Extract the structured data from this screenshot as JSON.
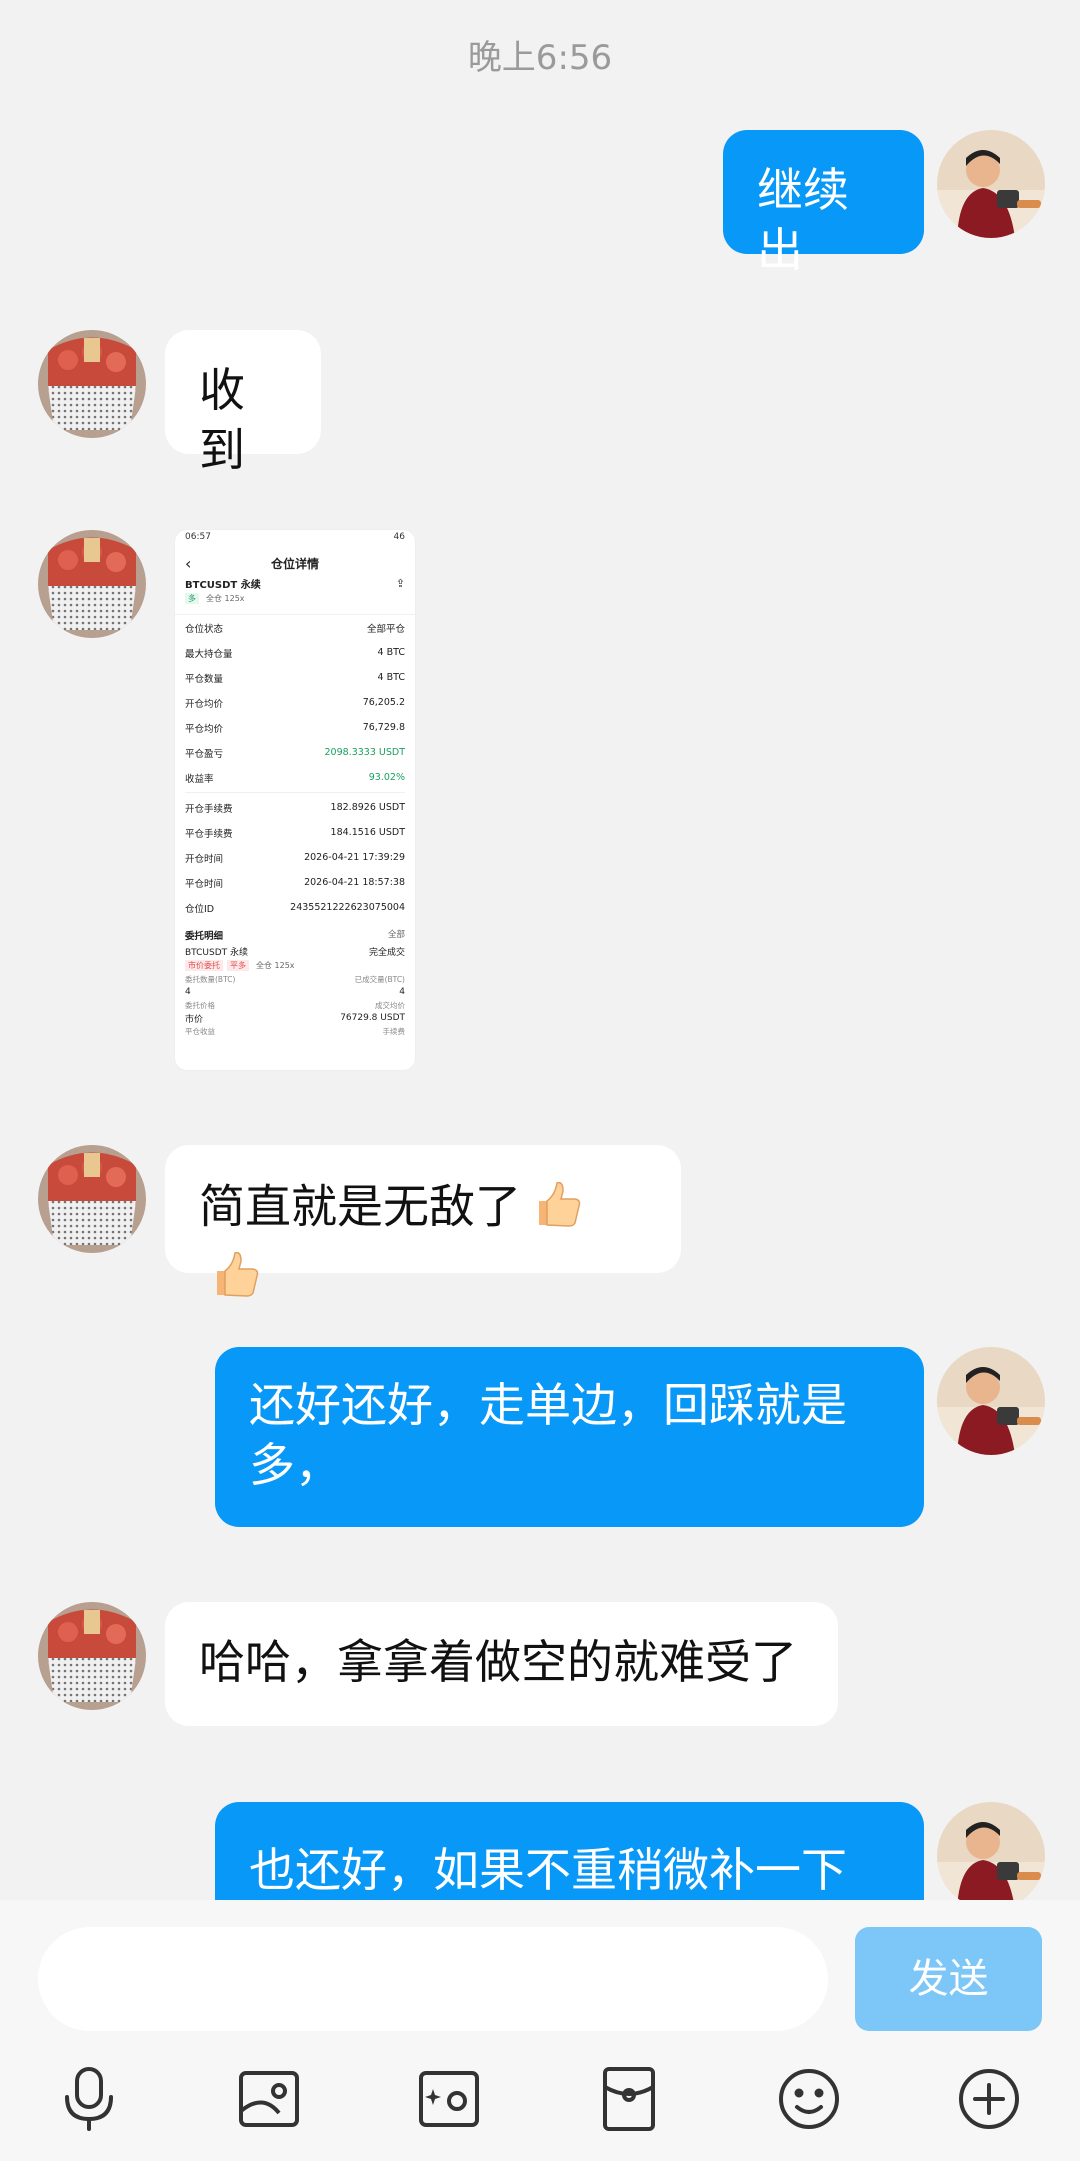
{
  "timestamp": "晚上6:56",
  "messages": [
    {
      "from": "me",
      "text": "继续出"
    },
    {
      "from": "them",
      "text": "收到"
    },
    {
      "from": "them",
      "type": "image"
    },
    {
      "from": "them",
      "text": "简直就是无敌了",
      "emoji": "thumbs-up x2"
    },
    {
      "from": "me",
      "text": "还好还好，走单边，回踩就是多，"
    },
    {
      "from": "them",
      "text": "哈哈，拿拿着做空的就难受了"
    },
    {
      "from": "me",
      "text": "也还好，如果不重稍微补一下"
    }
  ],
  "screenshot": {
    "time": "06:57",
    "battery": "46",
    "title": "仓位详情",
    "pair": "BTCUSDT 永续",
    "tag_side": "多",
    "tag_mode": "全仓 125x",
    "rows": [
      {
        "label": "仓位状态",
        "value": "全部平仓"
      },
      {
        "label": "最大持仓量",
        "value": "4 BTC"
      },
      {
        "label": "平仓数量",
        "value": "4 BTC"
      },
      {
        "label": "开仓均价",
        "value": "76,205.2"
      },
      {
        "label": "平仓均价",
        "value": "76,729.8"
      },
      {
        "label": "平仓盈亏",
        "value": "2098.3333 USDT",
        "green": true
      },
      {
        "label": "收益率",
        "value": "93.02%",
        "green": true
      },
      {
        "label": "开仓手续费",
        "value": "182.8926 USDT"
      },
      {
        "label": "平仓手续费",
        "value": "184.1516 USDT"
      },
      {
        "label": "开仓时间",
        "value": "2026-04-21 17:39:29"
      },
      {
        "label": "平仓时间",
        "value": "2026-04-21 18:57:38"
      },
      {
        "label": "仓位ID",
        "value": "2435521222623075004"
      }
    ],
    "section_title": "委托明细",
    "section_filter": "全部",
    "order_pair": "BTCUSDT 永续",
    "order_status": "完全成交",
    "order_tag1": "市价委托",
    "order_tag2": "平多",
    "order_tag3": "全仓 125x",
    "order_qty_label": "委托数量(BTC)",
    "order_filled_label": "已成交量(BTC)",
    "order_qty": "4",
    "order_filled": "4",
    "order_price_label": "委托价格",
    "order_avg_label": "成交均价",
    "order_price": "市价",
    "order_avg": "76729.8 USDT",
    "order_pnl_label": "平仓收益",
    "order_fee_label": "手续费"
  },
  "input": {
    "send_label": "发送"
  },
  "toolbar": [
    "microphone-icon",
    "image-icon",
    "camera-icon",
    "red-packet-icon",
    "emoji-icon",
    "plus-icon"
  ],
  "colors": {
    "my_bubble": "#0898f8",
    "send_button": "#7cc6f8",
    "background": "#f2f2f2"
  }
}
